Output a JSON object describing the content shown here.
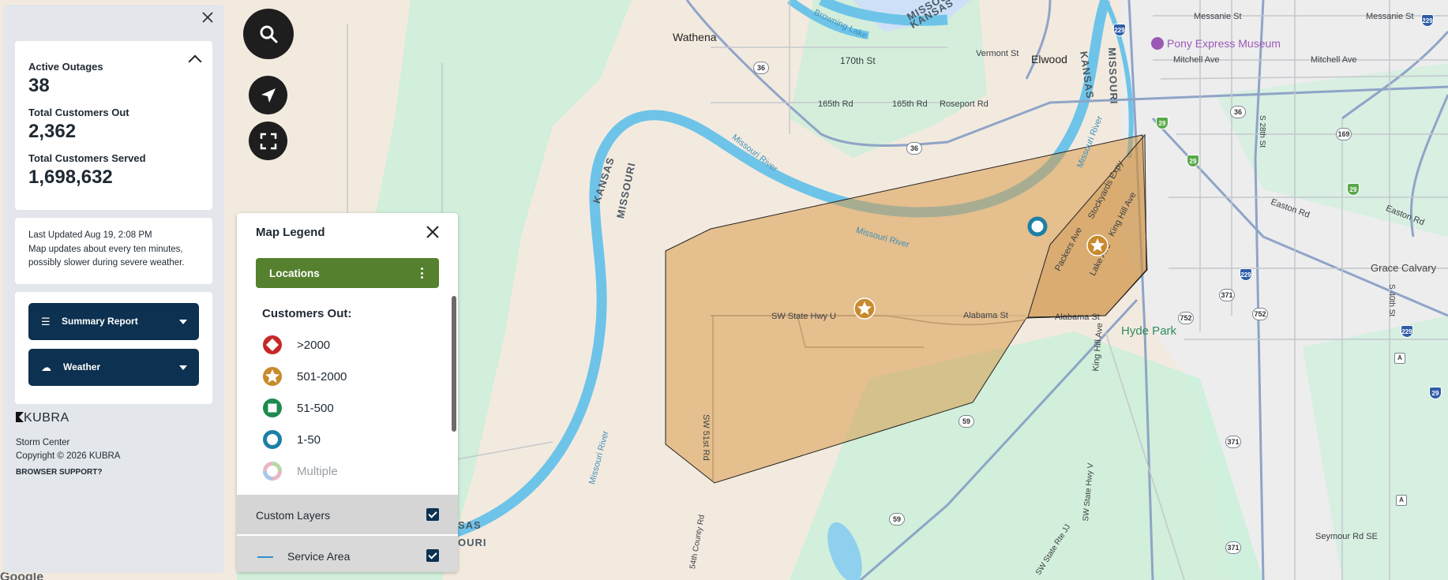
{
  "panel": {
    "stats": [
      {
        "label": "Active Outages",
        "value": "38"
      },
      {
        "label": "Total Customers Out",
        "value": "2,362"
      },
      {
        "label": "Total Customers Served",
        "value": "1,698,632"
      }
    ],
    "last_updated": "Last Updated  Aug 19, 2:08 PM",
    "update_note_1": "Map updates about every ten minutes,",
    "update_note_2": "possibly slower during severe weather.",
    "buttons": [
      {
        "label": "Summary Report",
        "icon": "list-icon"
      },
      {
        "label": "Weather",
        "icon": "weather-icon"
      }
    ],
    "brand": "KUBRA",
    "product": "Storm Center",
    "copyright": "Copyright © 2026 KUBRA",
    "browser_support": "BROWSER SUPPORT?"
  },
  "legend": {
    "title": "Map Legend",
    "locations_label": "Locations",
    "customers_out_label": "Customers Out:",
    "items": [
      {
        "label": ">2000",
        "shape": "diamond",
        "color": "#c62828"
      },
      {
        "label": "501-2000",
        "shape": "star",
        "color": "#c78a2c"
      },
      {
        "label": "51-500",
        "shape": "square",
        "color": "#1e8a4c"
      },
      {
        "label": "1-50",
        "shape": "ring",
        "color": "#1c7fa6"
      },
      {
        "label": "Multiple",
        "shape": "multi",
        "color": "#e0a0b0"
      }
    ],
    "custom_layers_label": "Custom Layers",
    "service_area_label": "Service Area"
  },
  "map": {
    "labels": {
      "wathena": "Wathena",
      "elwood": "Elwood",
      "st_170": "170th St",
      "vermont_st": "Vermont St",
      "rd_165_a": "165th Rd",
      "rd_165_b": "165th Rd",
      "roseport_rd": "Roseport Rd",
      "kansas_left": "KANSAS",
      "missouri_left": "MISSOURI",
      "kansas_top": "KANSAS",
      "missouri_top": "MISSOURI",
      "kansas_right": "KANSAS",
      "missouri_right": "MISSOURI",
      "kansas_bottom": "SAS",
      "missouri_bottom": "OURI",
      "browning_lake": "Browning Lake",
      "missouri_river_a": "Missouri River",
      "missouri_river_b": "Missouri River",
      "missouri_river_c": "Missouri River",
      "missouri_river_d": "Missouri River",
      "sw_state_hwy_u": "SW State Hwy U",
      "alabama_st_a": "Alabama St",
      "alabama_st_b": "Alabama St",
      "sw_51st_rd": "SW 51st Rd",
      "co_54th_rd": "54th County Rd",
      "packers_ave": "Packers Ave",
      "stockyards_expy": "Stockyards Expy",
      "lake_ave": "Lake Ave",
      "king_hill_ave": "King Hill Ave",
      "king_hill_ave_2": "King Hill Ave",
      "messanie_st_a": "Messanie St",
      "messanie_st_b": "Messanie St",
      "mitchell_ave_a": "Mitchell Ave",
      "mitchell_ave_b": "Mitchell Ave",
      "pony_express": "Pony Express Museum",
      "easton_rd_a": "Easton Rd",
      "easton_rd_b": "Easton Rd",
      "grace_calvary": "Grace Calvary",
      "hyde_park": "Hyde Park",
      "st_28th": "S 28th St",
      "st_40th": "S 40th St",
      "sw_state_hwy_v": "SW State Hwy V",
      "sw_state_rte_jj": "SW State Rte JJ",
      "seymour_rd": "Seymour Rd SE"
    },
    "shields": [
      "36",
      "36",
      "229",
      "229",
      "29",
      "29",
      "29",
      "36",
      "169",
      "229",
      "229",
      "371",
      "752",
      "752",
      "371",
      "371",
      "59",
      "59",
      "A",
      "A",
      "29"
    ],
    "google": "Google"
  }
}
